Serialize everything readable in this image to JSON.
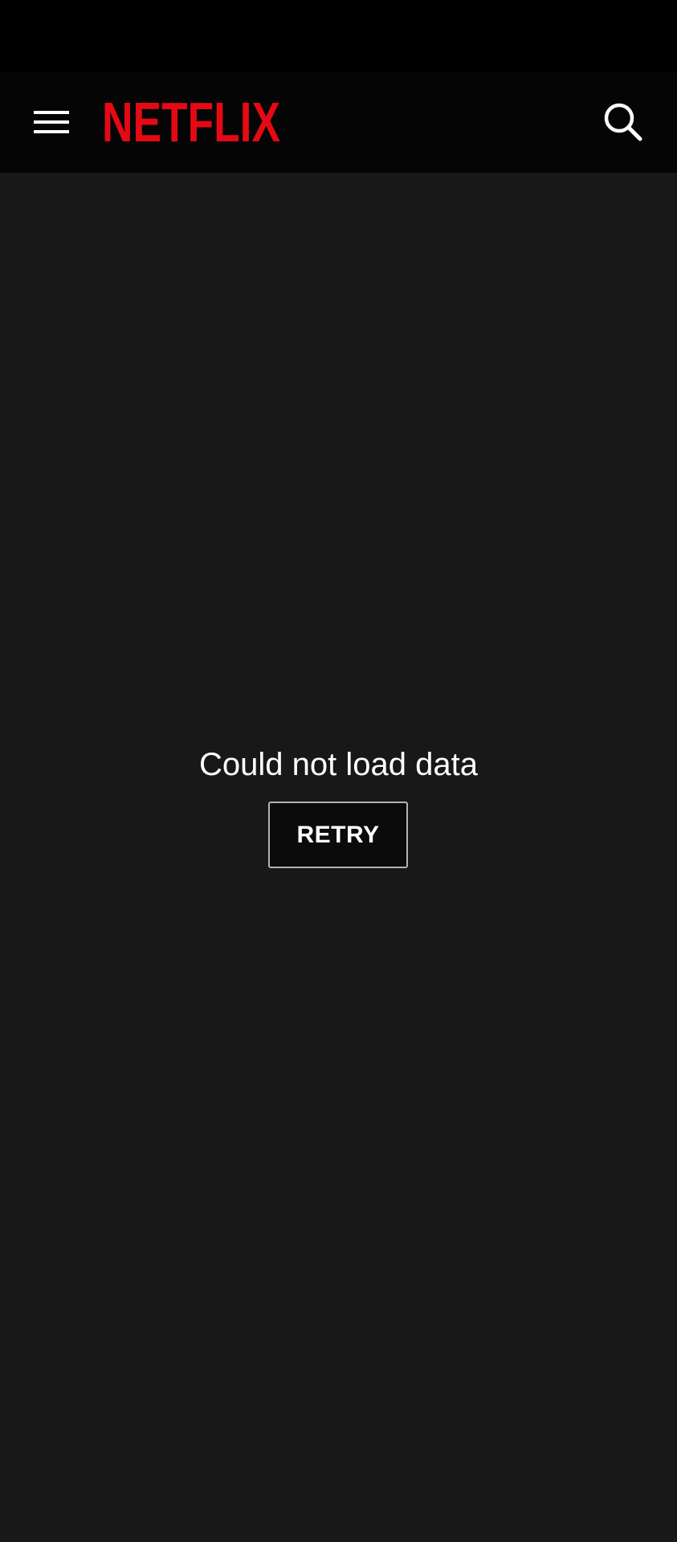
{
  "app": {
    "logo_text": "NETFLIX",
    "brand_color": "#E50914"
  },
  "app_bar": {
    "menu_icon": "hamburger-menu-icon",
    "search_icon": "search-icon"
  },
  "error": {
    "message": "Could not load data",
    "retry_label": "RETRY"
  },
  "colors": {
    "background": "#181818",
    "app_bar": "#050505",
    "status_bar": "#000000",
    "text": "#ffffff",
    "button_border": "#b3b3b3"
  }
}
